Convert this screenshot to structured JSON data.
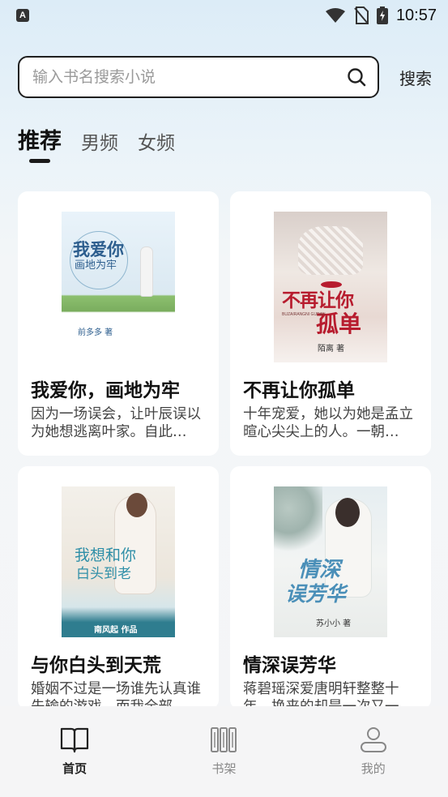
{
  "status": {
    "app_icon_letter": "A",
    "time": "10:57"
  },
  "search": {
    "placeholder": "输入书名搜索小说",
    "button_label": "搜索"
  },
  "tabs": [
    {
      "label": "推荐",
      "active": true
    },
    {
      "label": "男频",
      "active": false
    },
    {
      "label": "女频",
      "active": false
    }
  ],
  "books": [
    {
      "title": "我爱你，画地为牢",
      "description": "因为一场误会，让叶辰误以为她想逃离叶家。自此…",
      "cover_title_lines": [
        "我爱你",
        "画地为牢"
      ],
      "cover_author": "前多多 著",
      "cover_colors": [
        "#e6f1f8",
        "#7fb36a"
      ]
    },
    {
      "title": "不再让你孤单",
      "description": "十年宠爱，她以为她是孟立暄心尖尖上的人。一朝…",
      "cover_title_lines": [
        "不再让你",
        "孤单"
      ],
      "cover_subtitle": "BUZAIRANGNI GUDAN",
      "cover_author": "陌离 著",
      "cover_colors": [
        "#d8d0cc",
        "#b71c2e"
      ]
    },
    {
      "title": "与你白头到天荒",
      "description": "婚姻不过是一场谁先认真谁先输的游戏，而我全部…",
      "cover_title_lines": [
        "我想和你",
        "白头到老"
      ],
      "cover_author": "南风起 作品",
      "cover_colors": [
        "#f2efe9",
        "#2f8fa8"
      ]
    },
    {
      "title": "情深误芳华",
      "description": "蒋碧瑶深爱唐明轩整整十年，换来的却是一次又一…",
      "cover_title_lines": [
        "情深",
        "误芳华"
      ],
      "cover_author": "苏小小 著",
      "cover_colors": [
        "#e3ecef",
        "#4a8fb8"
      ]
    }
  ],
  "nav": [
    {
      "label": "首页",
      "icon": "book-open-icon",
      "active": true
    },
    {
      "label": "书架",
      "icon": "bookshelf-icon",
      "active": false
    },
    {
      "label": "我的",
      "icon": "user-icon",
      "active": false
    }
  ]
}
